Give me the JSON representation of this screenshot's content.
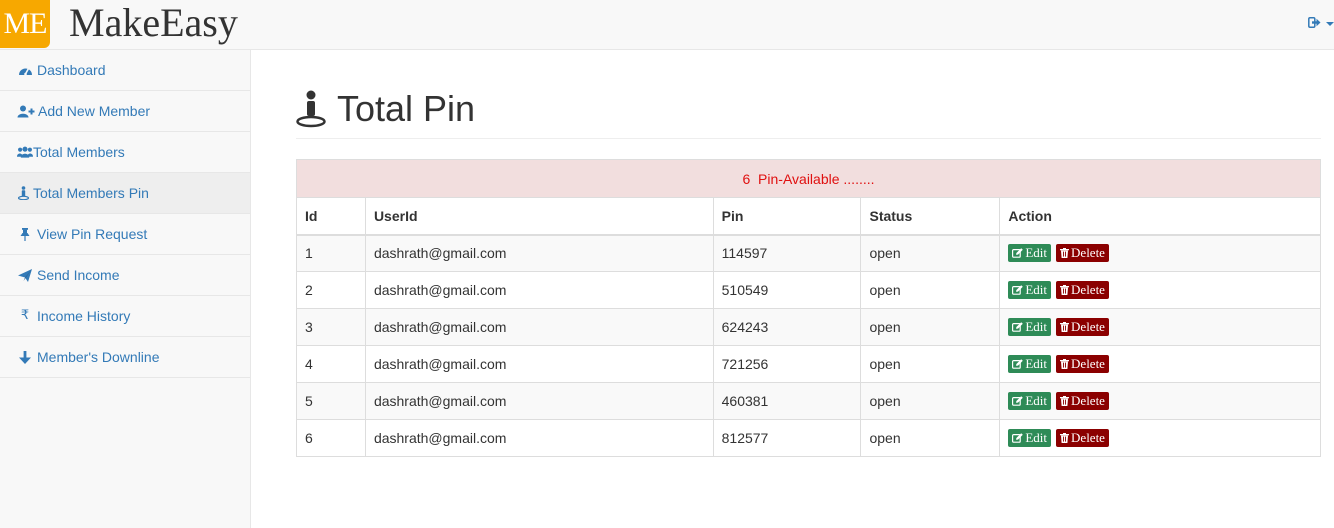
{
  "header": {
    "logo_text": "ME",
    "brand": "MakeEasy",
    "user_menu_icon": "sign-out-icon"
  },
  "sidebar": {
    "items": [
      {
        "label": "Dashboard",
        "icon": "dashboard-icon"
      },
      {
        "label": "Add New Member",
        "icon": "user-plus-icon"
      },
      {
        "label": "Total Members",
        "icon": "users-icon"
      },
      {
        "label": "Total Members Pin",
        "icon": "person-pin-icon",
        "active": true
      },
      {
        "label": "View Pin Request",
        "icon": "thumbtack-icon"
      },
      {
        "label": "Send Income",
        "icon": "paper-plane-icon"
      },
      {
        "label": "Income History",
        "icon": "rupee-icon"
      },
      {
        "label": "Member's Downline",
        "icon": "arrow-down-icon"
      }
    ]
  },
  "main": {
    "title": "Total Pin",
    "alert_count": "6",
    "alert_text": "Pin-Available ........",
    "columns": [
      "Id",
      "UserId",
      "Pin",
      "Status",
      "Action"
    ],
    "rows": [
      {
        "id": "1",
        "user": "dashrath@gmail.com",
        "pin": "114597",
        "status": "open"
      },
      {
        "id": "2",
        "user": "dashrath@gmail.com",
        "pin": "510549",
        "status": "open"
      },
      {
        "id": "3",
        "user": "dashrath@gmail.com",
        "pin": "624243",
        "status": "open"
      },
      {
        "id": "4",
        "user": "dashrath@gmail.com",
        "pin": "721256",
        "status": "open"
      },
      {
        "id": "5",
        "user": "dashrath@gmail.com",
        "pin": "460381",
        "status": "open"
      },
      {
        "id": "6",
        "user": "dashrath@gmail.com",
        "pin": "812577",
        "status": "open"
      }
    ],
    "edit_label": "Edit",
    "delete_label": "Delete"
  },
  "colors": {
    "logo": "#f7a800",
    "link": "#337ab7",
    "alert_bg": "#f2dede",
    "alert_text": "#e01010",
    "edit": "#2e8b57",
    "delete": "#8b0000"
  }
}
